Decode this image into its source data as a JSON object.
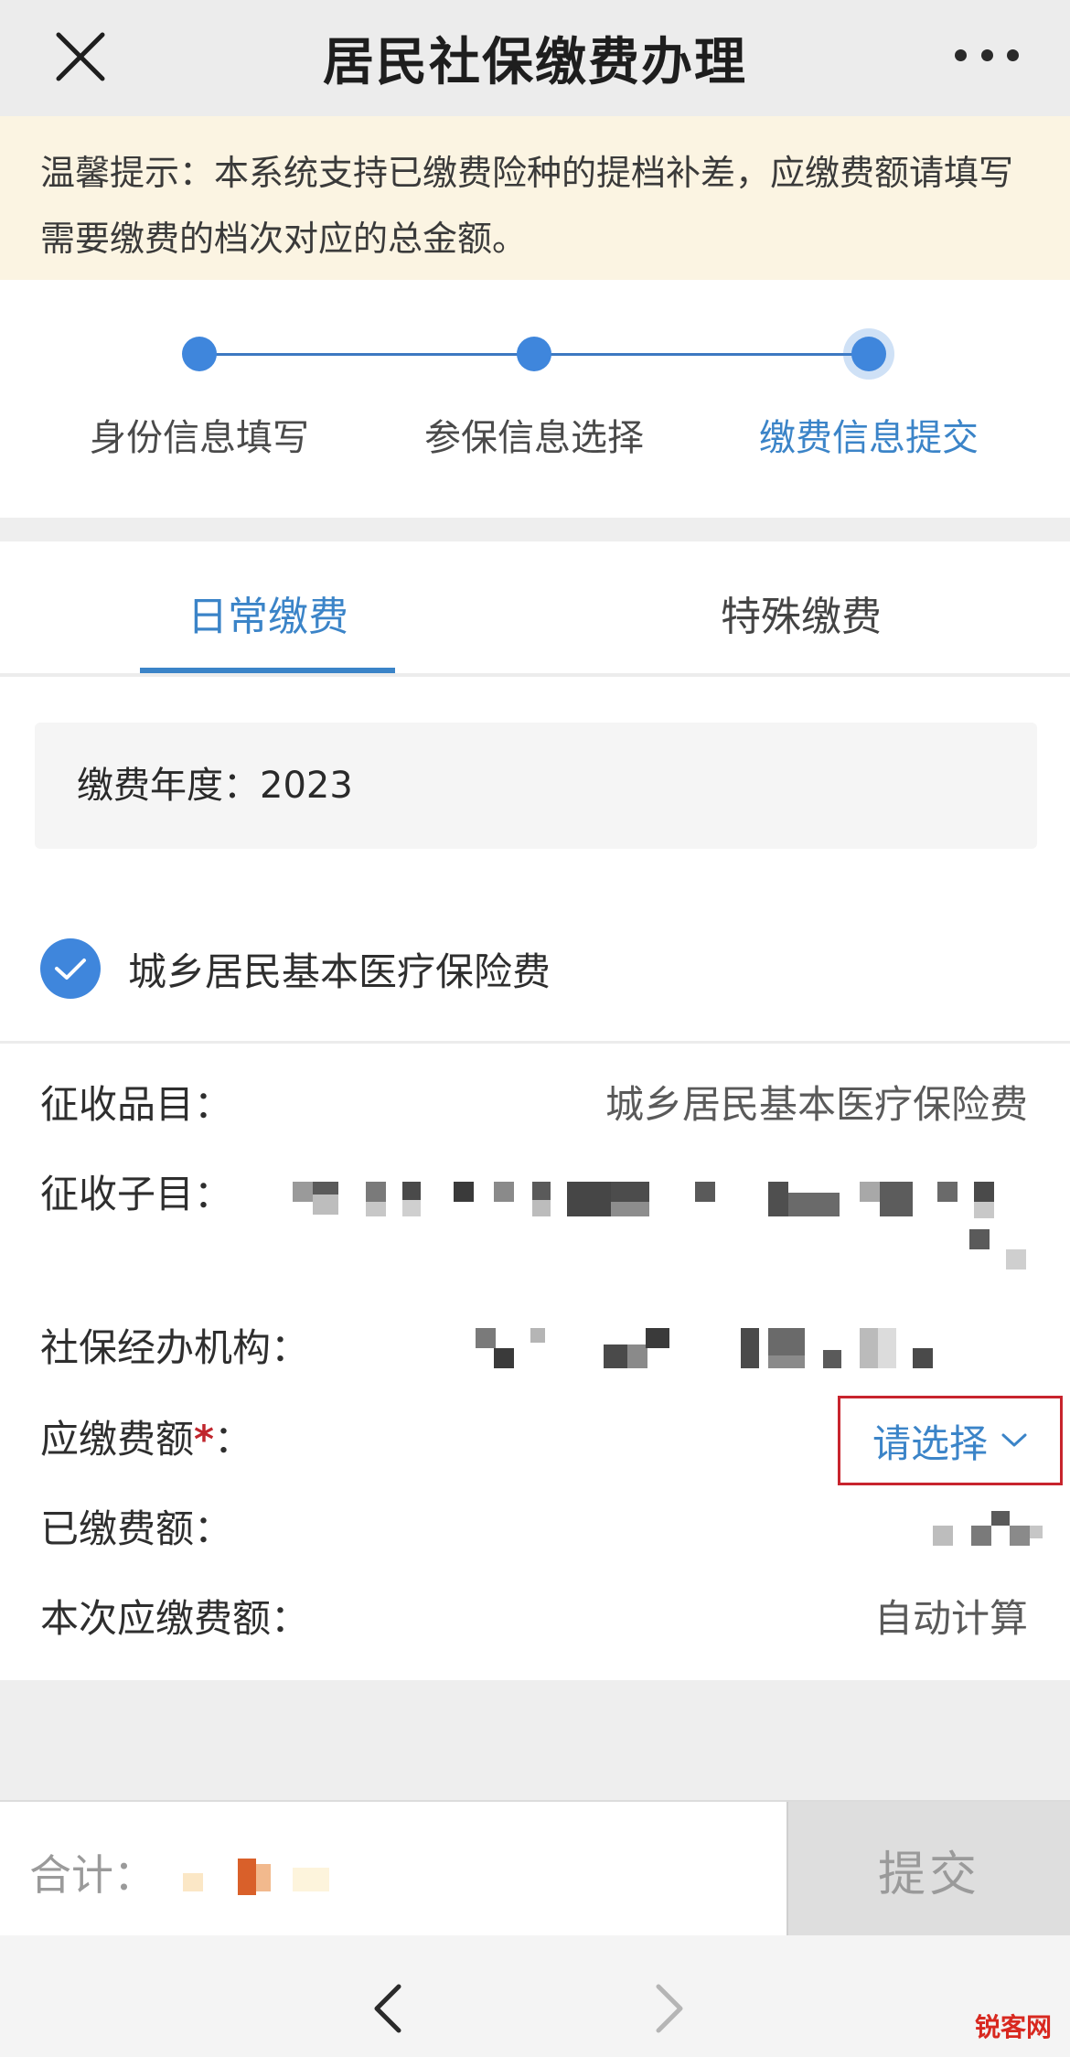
{
  "header": {
    "title": "居民社保缴费办理"
  },
  "notice": {
    "text": "温馨提示：本系统支持已缴费险种的提档补差，应缴费额请填写需要缴费的档次对应的总金额。"
  },
  "steps": [
    {
      "label": "身份信息填写",
      "state": "done"
    },
    {
      "label": "参保信息选择",
      "state": "done"
    },
    {
      "label": "缴费信息提交",
      "state": "active"
    }
  ],
  "tabs": [
    {
      "label": "日常缴费",
      "active": true
    },
    {
      "label": "特殊缴费",
      "active": false
    }
  ],
  "year": {
    "label": "缴费年度：",
    "value": "2023"
  },
  "insurance": {
    "label": "城乡居民基本医疗保险费",
    "checked": true
  },
  "details": {
    "item_label": "征收品目：",
    "item_value": "城乡居民基本医疗保险费",
    "subitem_label": "征收子目：",
    "agency_label": "社保经办机构：",
    "due_label": "应缴费额",
    "required_mark": "*",
    "due_colon": "：",
    "due_select": "请选择",
    "paid_label": "已缴费额：",
    "current_label": "本次应缴费额：",
    "current_value": "自动计算"
  },
  "bottom": {
    "total_label": "合计：",
    "submit_label": "提交"
  },
  "watermark": "锐客网",
  "colors": {
    "accent": "#3f86dc",
    "accent_text": "#3b84c8",
    "notice_bg": "#fbf4e2",
    "highlight_border": "#c8242d"
  }
}
